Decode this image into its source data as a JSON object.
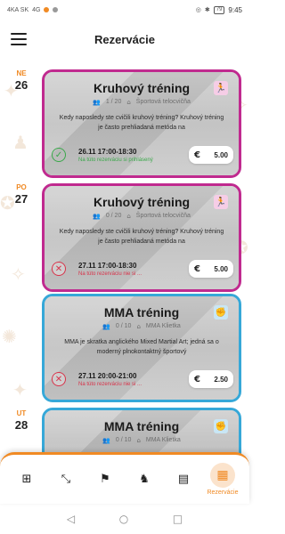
{
  "status_bar": {
    "carrier": "4KA SK",
    "network": "4G",
    "battery": "79",
    "time": "9:45"
  },
  "header": {
    "title": "Rezervácie"
  },
  "days": [
    {
      "dow": "NE",
      "day": "26"
    },
    {
      "dow": "PO",
      "day": "27"
    },
    {
      "dow": "UT",
      "day": "28"
    }
  ],
  "cards": [
    {
      "title": "Kruhový tréning",
      "capacity": "1 / 20",
      "location": "Športová telocvičňa",
      "description": "Kedy naposledy ste cvičili kruhový tréning? Kruhový tréning je často prehliadaná metóda na",
      "when": "26.11 17:00-18:30",
      "note": "Na túto rezerváciu si prihlásený",
      "currency": "€",
      "price": "5.00"
    },
    {
      "title": "Kruhový tréning",
      "capacity": "0 / 20",
      "location": "Športová telocvičňa",
      "description": "Kedy naposledy ste cvičili kruhový tréning? Kruhový tréning je často prehliadaná metóda na",
      "when": "27.11 17:00-18:30",
      "note": "Na túto rezerváciu nie si ...",
      "currency": "€",
      "price": "5.00"
    },
    {
      "title": "MMA tréning",
      "capacity": "0 / 10",
      "location": "MMA Klietka",
      "description": "MMA je skratka anglického Mixed Martial Art; jedná sa o moderný plnokontaktný športový",
      "when": "27.11 20:00-21:00",
      "note": "Na túto rezerváciu nie si ...",
      "currency": "€",
      "price": "2.50"
    },
    {
      "title": "MMA tréning",
      "capacity": "0 / 10",
      "location": "MMA Klietka"
    }
  ],
  "bottom_nav": {
    "active_label": "Rezervácie",
    "items": [
      "qr-icon",
      "dumbbell-icon",
      "finish-flag-icon",
      "karate-icon",
      "schedule-icon",
      "calendar-icon"
    ]
  },
  "colors": {
    "accent": "#f08a24",
    "circuit_border": "#c02a8f",
    "mma_border": "#36a8d8",
    "success": "#3aa84a",
    "error": "#d8334a"
  }
}
